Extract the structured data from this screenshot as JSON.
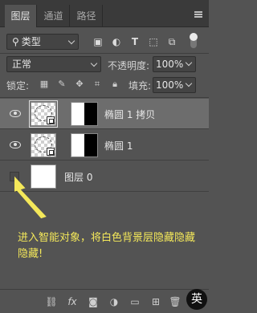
{
  "tabs": [
    "图层",
    "通道",
    "路径"
  ],
  "filter": {
    "kind_label": "类型"
  },
  "blend": {
    "mode": "正常",
    "opacity_label": "不透明度:",
    "opacity_value": "100%"
  },
  "lock": {
    "label": "锁定:",
    "fill_label": "填充:",
    "fill_value": "100%"
  },
  "layers": [
    {
      "name": "椭圆 1 拷贝",
      "visible": true,
      "selected": true
    },
    {
      "name": "椭圆 1",
      "visible": true,
      "selected": false
    },
    {
      "name": "图层 0",
      "visible": false,
      "selected": false
    }
  ],
  "annotation": {
    "text": "进入智能对象，将白色背景层隐藏隐藏隐藏!"
  },
  "bottom": {
    "fx_label": "fx"
  },
  "ime": {
    "label": "英"
  },
  "colors": {
    "annotation": "#f4e85a",
    "panel": "#535353",
    "selected_row": "#6d6d6d"
  }
}
